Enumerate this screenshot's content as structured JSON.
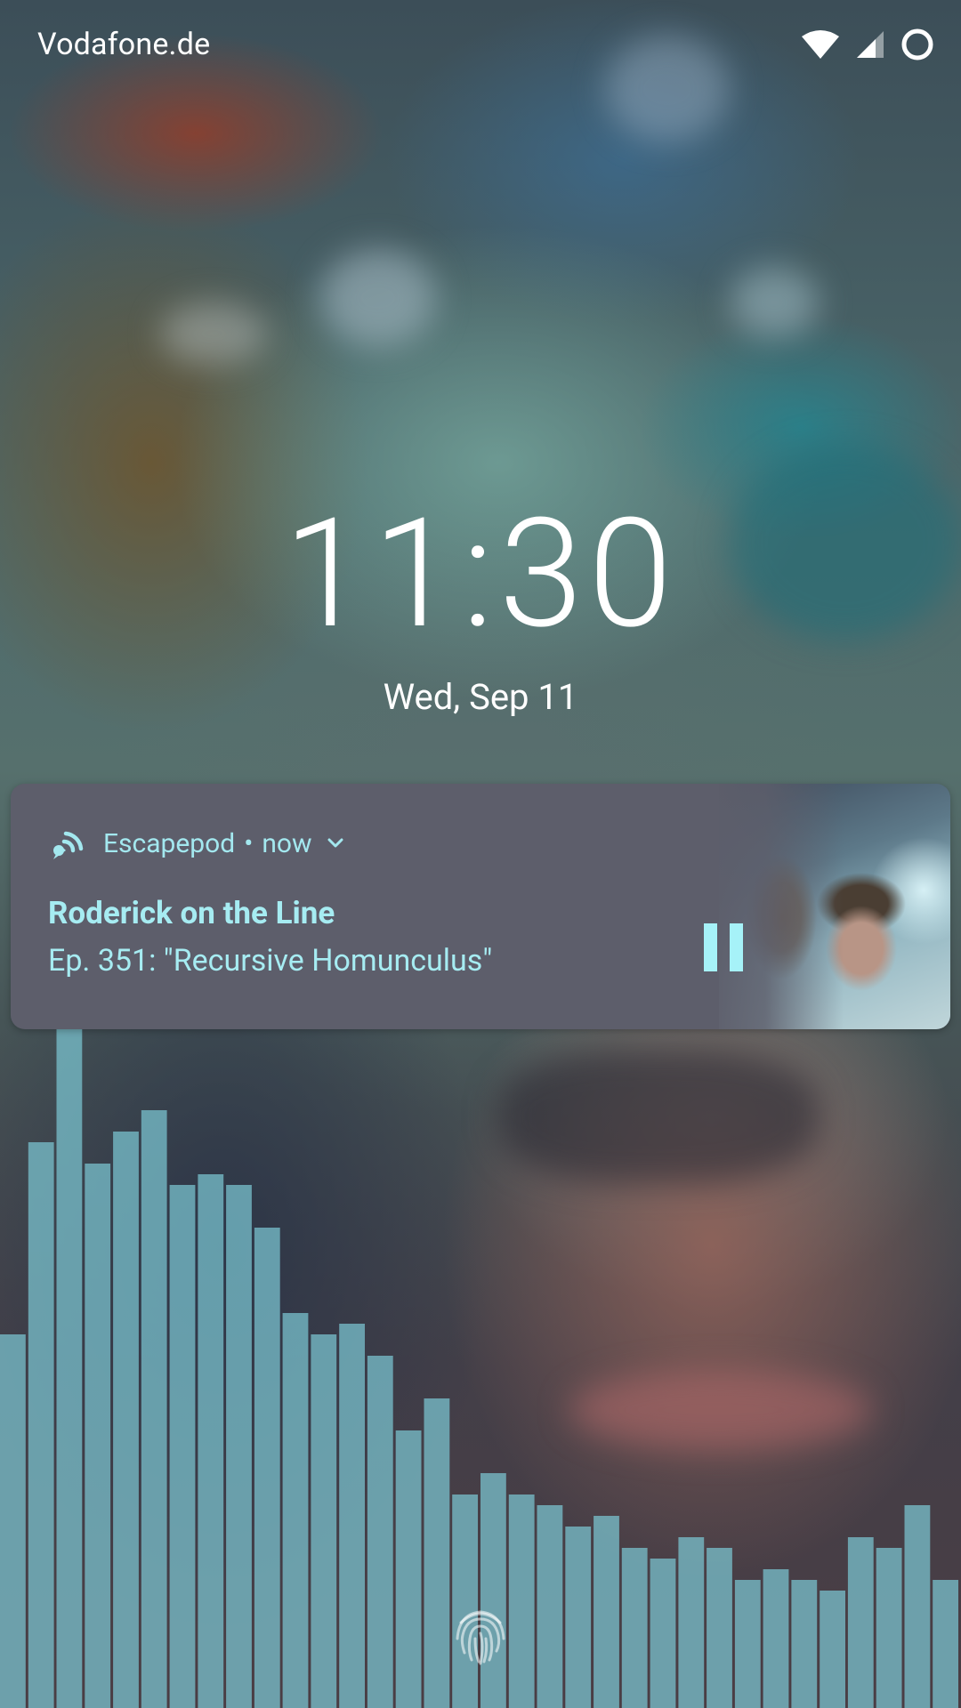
{
  "status_bar": {
    "carrier": "Vodafone.de",
    "icons": [
      "wifi-icon",
      "cell-signal-icon",
      "battery-circle-icon"
    ]
  },
  "lockscreen": {
    "time": "11:30",
    "date": "Wed, Sep 11"
  },
  "notification": {
    "app_icon": "podcast-feed-icon",
    "app_name": "Escapepod",
    "separator": "•",
    "time": "now",
    "title": "Roderick on the Line",
    "text": "Ep. 351: \"Recursive Homunculus\"",
    "action_icon": "pause-icon",
    "accent_color": "#a6ecf2",
    "background_color": "#5d5e6b"
  },
  "visualizer": {
    "color": "#7cc6d2",
    "levels": [
      0.35,
      0.53,
      0.64,
      0.51,
      0.54,
      0.56,
      0.49,
      0.5,
      0.49,
      0.45,
      0.37,
      0.35,
      0.36,
      0.33,
      0.26,
      0.29,
      0.2,
      0.22,
      0.2,
      0.19,
      0.17,
      0.18,
      0.15,
      0.14,
      0.16,
      0.15,
      0.12,
      0.13,
      0.12,
      0.11,
      0.16,
      0.15,
      0.19,
      0.12
    ]
  },
  "unlock": {
    "icon": "fingerprint-icon"
  }
}
